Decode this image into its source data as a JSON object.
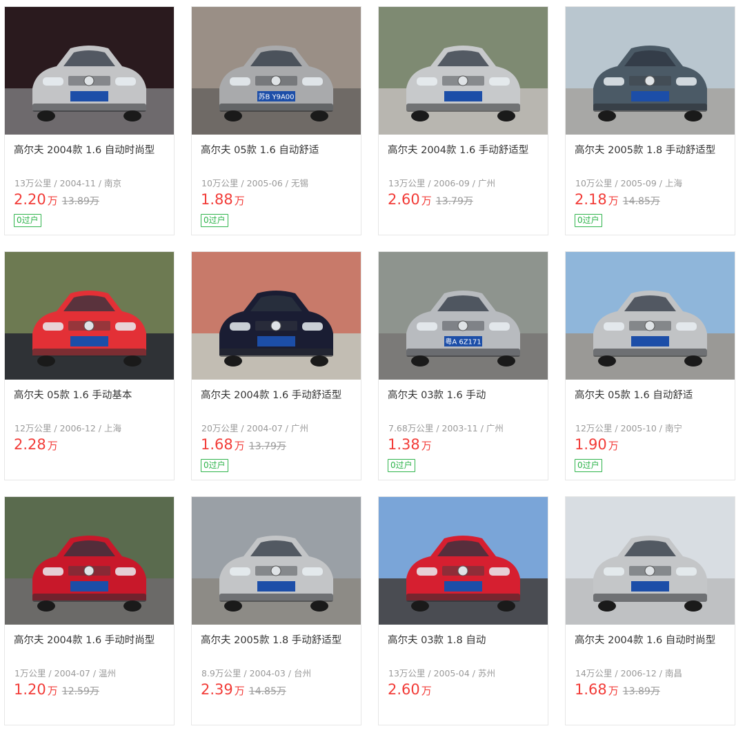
{
  "listings": [
    {
      "title": "高尔夫 2004款 1.6 自动时尚型",
      "mileage": "13万公里",
      "date": "2004-11",
      "city": "南京",
      "price": "2.20",
      "unit": "万",
      "original_price": "13.89万",
      "badge": "0过户",
      "plate": "",
      "colors": {
        "bg": "#2a1a1e",
        "ground": "#6e6a6d",
        "car": "#c3c4c6"
      }
    },
    {
      "title": "高尔夫 05款 1.6 自动舒适",
      "mileage": "10万公里",
      "date": "2005-06",
      "city": "无锡",
      "price": "1.88",
      "unit": "万",
      "original_price": "",
      "badge": "0过户",
      "plate": "苏B Y9A00",
      "colors": {
        "bg": "#9a8f86",
        "ground": "#6f6a66",
        "car": "#a9aaac"
      }
    },
    {
      "title": "高尔夫 2004款 1.6 手动舒适型",
      "mileage": "13万公里",
      "date": "2006-09",
      "city": "广州",
      "price": "2.60",
      "unit": "万",
      "original_price": "13.79万",
      "badge": "",
      "plate": "",
      "colors": {
        "bg": "#7e8a72",
        "ground": "#b8b6b0",
        "car": "#c7c9cb"
      }
    },
    {
      "title": "高尔夫 2005款 1.8 手动舒适型",
      "mileage": "10万公里",
      "date": "2005-09",
      "city": "上海",
      "price": "2.18",
      "unit": "万",
      "original_price": "14.85万",
      "badge": "0过户",
      "plate": "",
      "colors": {
        "bg": "#b9c6cf",
        "ground": "#a8a8a6",
        "car": "#4b5a66"
      }
    },
    {
      "title": "高尔夫 05款 1.6 手动基本",
      "mileage": "12万公里",
      "date": "2006-12",
      "city": "上海",
      "price": "2.28",
      "unit": "万",
      "original_price": "",
      "badge": "",
      "plate": "",
      "colors": {
        "bg": "#6d7a52",
        "ground": "#2f3236",
        "car": "#e33036"
      }
    },
    {
      "title": "高尔夫 2004款 1.6 手动舒适型",
      "mileage": "20万公里",
      "date": "2004-07",
      "city": "广州",
      "price": "1.68",
      "unit": "万",
      "original_price": "13.79万",
      "badge": "0过户",
      "plate": "",
      "colors": {
        "bg": "#c87a6a",
        "ground": "#c2bdb3",
        "car": "#1a1d33"
      }
    },
    {
      "title": "高尔夫 03款 1.6 手动",
      "mileage": "7.68万公里",
      "date": "2003-11",
      "city": "广州",
      "price": "1.38",
      "unit": "万",
      "original_price": "",
      "badge": "0过户",
      "plate": "粤A 6Z171",
      "colors": {
        "bg": "#8e948e",
        "ground": "#7b7a78",
        "car": "#b8bbbf"
      }
    },
    {
      "title": "高尔夫 05款 1.6 自动舒适",
      "mileage": "12万公里",
      "date": "2005-10",
      "city": "南宁",
      "price": "1.90",
      "unit": "万",
      "original_price": "",
      "badge": "0过户",
      "plate": "",
      "colors": {
        "bg": "#8fb6da",
        "ground": "#9a9996",
        "car": "#c1c3c5"
      }
    },
    {
      "title": "高尔夫 2004款 1.6 手动时尚型",
      "mileage": "1万公里",
      "date": "2004-07",
      "city": "温州",
      "price": "1.20",
      "unit": "万",
      "original_price": "12.59万",
      "badge": "",
      "plate": "",
      "colors": {
        "bg": "#5a6b4e",
        "ground": "#6b6a68",
        "car": "#c8182a"
      }
    },
    {
      "title": "高尔夫 2005款 1.8 手动舒适型",
      "mileage": "8.9万公里",
      "date": "2004-03",
      "city": "台州",
      "price": "2.39",
      "unit": "万",
      "original_price": "14.85万",
      "badge": "",
      "plate": "",
      "colors": {
        "bg": "#9aa0a6",
        "ground": "#8d8b86",
        "car": "#c3c5c7"
      }
    },
    {
      "title": "高尔夫 03款 1.8 自动",
      "mileage": "13万公里",
      "date": "2005-04",
      "city": "苏州",
      "price": "2.60",
      "unit": "万",
      "original_price": "",
      "badge": "",
      "plate": "",
      "colors": {
        "bg": "#7aa5d8",
        "ground": "#4a4c52",
        "car": "#d61f30"
      }
    },
    {
      "title": "高尔夫 2004款 1.6 自动时尚型",
      "mileage": "14万公里",
      "date": "2006-12",
      "city": "南昌",
      "price": "1.68",
      "unit": "万",
      "original_price": "13.89万",
      "badge": "",
      "plate": "",
      "colors": {
        "bg": "#d8dde2",
        "ground": "#bfc1c3",
        "car": "#c4c6c8"
      }
    }
  ]
}
